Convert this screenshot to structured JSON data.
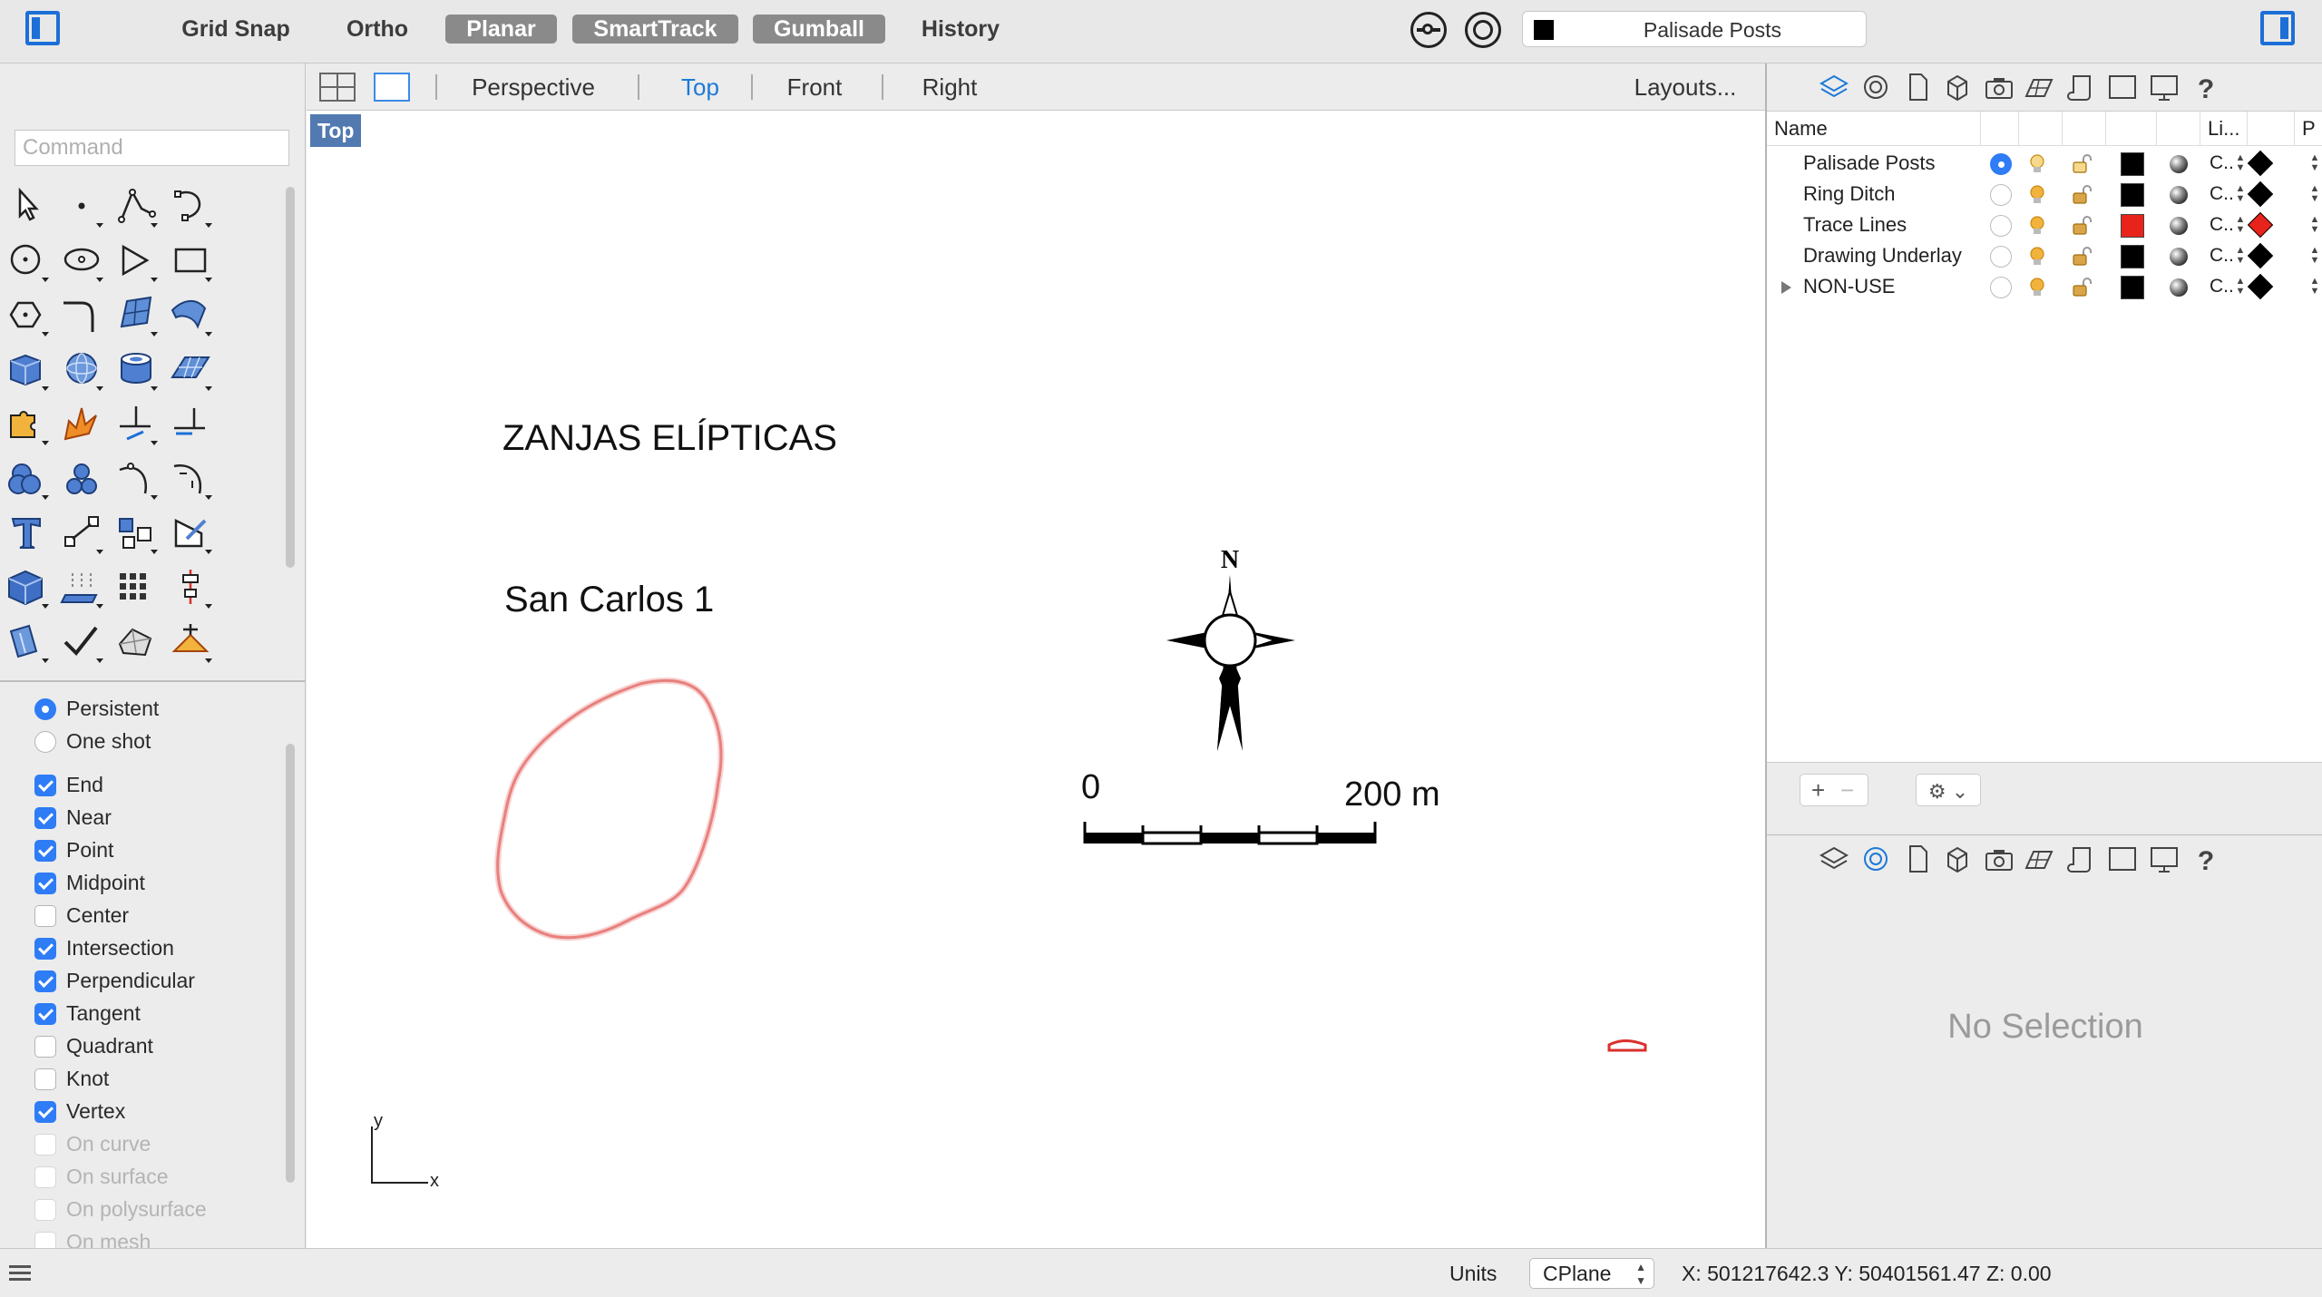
{
  "toolbar": {
    "grid_snap": "Grid Snap",
    "ortho": "Ortho",
    "planar": "Planar",
    "smarttrack": "SmartTrack",
    "gumball": "Gumball",
    "history": "History",
    "current_layer": "Palisade Posts"
  },
  "command": {
    "placeholder": "Command"
  },
  "viewport_tabs": {
    "perspective": "Perspective",
    "top": "Top",
    "front": "Front",
    "right": "Right",
    "layouts": "Layouts..."
  },
  "viewport": {
    "label": "Top",
    "title": "ZANJAS ELÍPTICAS",
    "subtitle": "San Carlos 1",
    "north": "N",
    "scale_start": "0",
    "scale_end": "200 m",
    "axis_x": "x",
    "axis_y": "y"
  },
  "osnap": {
    "persistent": "Persistent",
    "one_shot": "One shot",
    "end": "End",
    "near": "Near",
    "point": "Point",
    "midpoint": "Midpoint",
    "center": "Center",
    "intersection": "Intersection",
    "perpendicular": "Perpendicular",
    "tangent": "Tangent",
    "quadrant": "Quadrant",
    "knot": "Knot",
    "vertex": "Vertex",
    "on_curve": "On curve",
    "on_surface": "On surface",
    "on_polysurface": "On polysurface",
    "on_mesh": "On mesh"
  },
  "layers": {
    "header_name": "Name",
    "header_linetype": "Li...",
    "header_print": "P",
    "rows": [
      {
        "name": "Palisade Posts",
        "color": "#000000",
        "linetype": "C..",
        "print_color": "#000000"
      },
      {
        "name": "Ring Ditch",
        "color": "#000000",
        "linetype": "C..",
        "print_color": "#000000"
      },
      {
        "name": "Trace Lines",
        "color": "#e8231c",
        "linetype": "C..",
        "print_color": "#e8231c"
      },
      {
        "name": "Drawing Underlay",
        "color": "#000000",
        "linetype": "C..",
        "print_color": "#000000"
      },
      {
        "name": "NON-USE",
        "color": "#000000",
        "linetype": "C..",
        "print_color": "#000000"
      }
    ]
  },
  "properties": {
    "empty": "No Selection"
  },
  "status": {
    "units": "Units",
    "cplane": "CPlane",
    "coords": "X: 501217642.3 Y: 50401561.47  Z: 0.00"
  },
  "colors": {
    "accent": "#1c6fd6",
    "trace_red": "#d9312d"
  }
}
